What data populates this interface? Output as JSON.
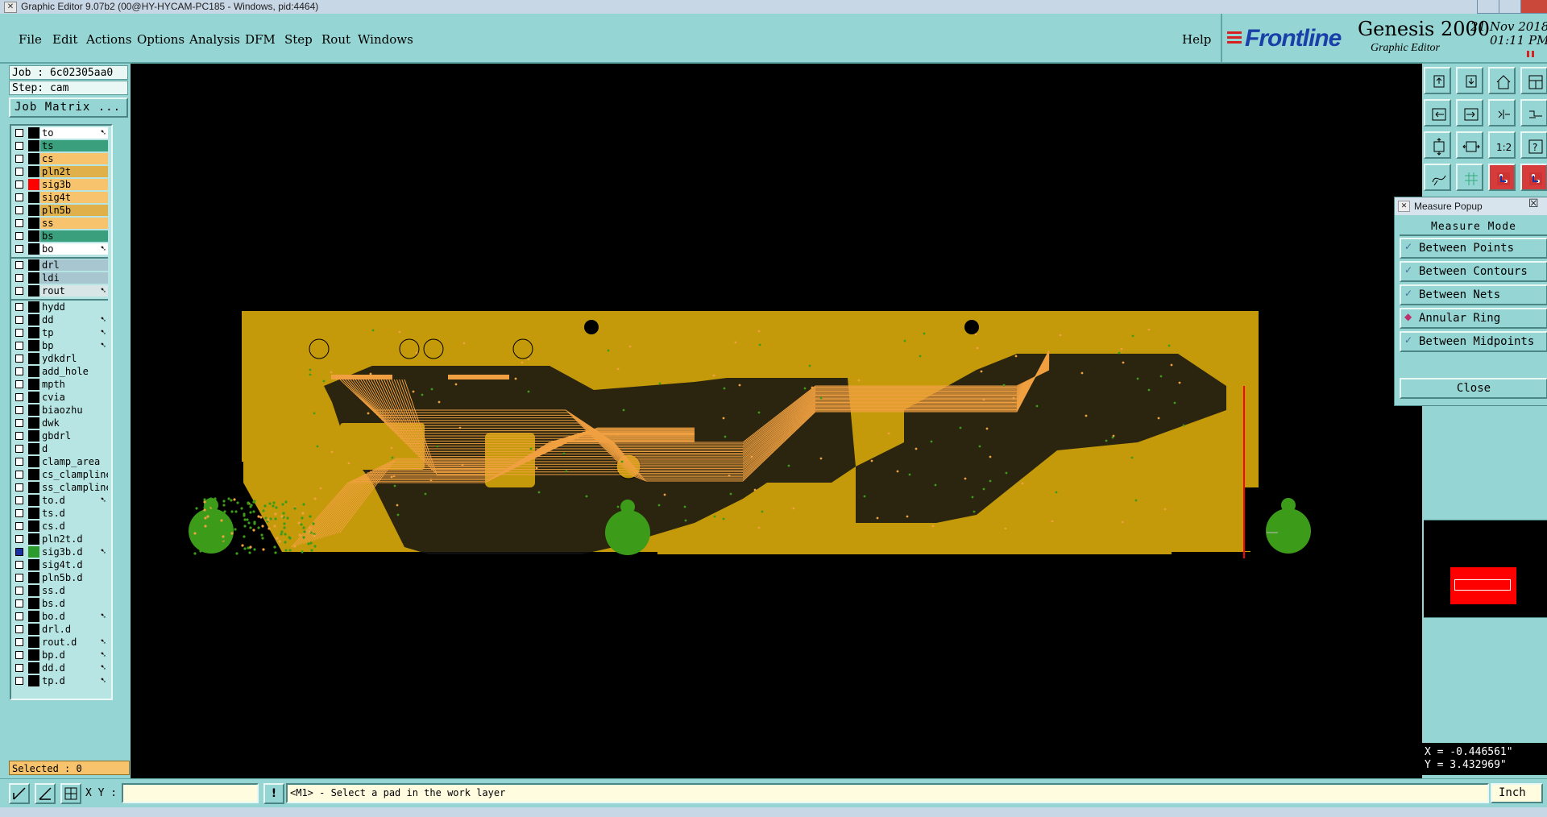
{
  "window": {
    "title": "Graphic Editor 9.07b2 (00@HY-HYCAM-PC185 - Windows, pid:4464)"
  },
  "menu": {
    "items": [
      {
        "label": "File"
      },
      {
        "label": "Edit"
      },
      {
        "label": "Actions"
      },
      {
        "label": "Options"
      },
      {
        "label": "Analysis"
      },
      {
        "label": "DFM"
      },
      {
        "label": "Step"
      },
      {
        "label": "Rout"
      },
      {
        "label": "Windows"
      }
    ],
    "help": "Help"
  },
  "brand": {
    "logo": "Frontline",
    "product": "Genesis 2000",
    "subtitle": "Graphic Editor",
    "date": "21 Nov 2018",
    "time": "01:11 PM"
  },
  "job": {
    "job_label": "Job : 6c02305aa0",
    "step_label": "Step: cam",
    "matrix_button": "Job Matrix ..."
  },
  "layers": [
    {
      "name": "to",
      "color": "#ffffff",
      "arrow": true,
      "marker": ""
    },
    {
      "name": "ts",
      "color": "#3a9f7d",
      "arrow": false,
      "marker": ""
    },
    {
      "name": "cs",
      "color": "#f7c36d",
      "arrow": false,
      "marker": ""
    },
    {
      "name": "pln2t",
      "color": "#e0b04a",
      "arrow": false,
      "marker": ""
    },
    {
      "name": "sig3b",
      "color": "#f7c36d",
      "arrow": false,
      "marker": "#ff0000"
    },
    {
      "name": "sig4t",
      "color": "#f7c36d",
      "arrow": false,
      "marker": ""
    },
    {
      "name": "pln5b",
      "color": "#e0b04a",
      "arrow": false,
      "marker": ""
    },
    {
      "name": "ss",
      "color": "#f7c36d",
      "arrow": false,
      "marker": ""
    },
    {
      "name": "bs",
      "color": "#3a9f7d",
      "arrow": false,
      "marker": ""
    },
    {
      "name": "bo",
      "color": "#ffffff",
      "arrow": true,
      "marker": ""
    },
    {
      "name": "drl",
      "color": "#a8c6cf",
      "arrow": false,
      "marker": ""
    },
    {
      "name": "ldi",
      "color": "#a8c6cf",
      "arrow": false,
      "marker": ""
    },
    {
      "name": "rout",
      "color": "#d9e6e8",
      "arrow": true,
      "marker": ""
    },
    {
      "name": "hydd",
      "color": "#b6e5e3",
      "arrow": false,
      "marker": ""
    },
    {
      "name": "dd",
      "color": "#b6e5e3",
      "arrow": true,
      "marker": ""
    },
    {
      "name": "tp",
      "color": "#b6e5e3",
      "arrow": true,
      "marker": ""
    },
    {
      "name": "bp",
      "color": "#b6e5e3",
      "arrow": true,
      "marker": ""
    },
    {
      "name": "ydkdrl",
      "color": "#b6e5e3",
      "arrow": false,
      "marker": ""
    },
    {
      "name": "add_hole",
      "color": "#b6e5e3",
      "arrow": false,
      "marker": ""
    },
    {
      "name": "mpth",
      "color": "#b6e5e3",
      "arrow": false,
      "marker": ""
    },
    {
      "name": "cvia",
      "color": "#b6e5e3",
      "arrow": false,
      "marker": ""
    },
    {
      "name": "biaozhu",
      "color": "#b6e5e3",
      "arrow": false,
      "marker": ""
    },
    {
      "name": "dwk",
      "color": "#b6e5e3",
      "arrow": false,
      "marker": ""
    },
    {
      "name": "gbdrl",
      "color": "#b6e5e3",
      "arrow": false,
      "marker": ""
    },
    {
      "name": "d",
      "color": "#b6e5e3",
      "arrow": false,
      "marker": ""
    },
    {
      "name": "clamp_area",
      "color": "#b6e5e3",
      "arrow": false,
      "marker": ""
    },
    {
      "name": "cs_clampline",
      "color": "#b6e5e3",
      "arrow": false,
      "marker": ""
    },
    {
      "name": "ss_clampline",
      "color": "#b6e5e3",
      "arrow": false,
      "marker": ""
    },
    {
      "name": "to.d",
      "color": "#b6e5e3",
      "arrow": true,
      "marker": ""
    },
    {
      "name": "ts.d",
      "color": "#b6e5e3",
      "arrow": false,
      "marker": ""
    },
    {
      "name": "cs.d",
      "color": "#b6e5e3",
      "arrow": false,
      "marker": ""
    },
    {
      "name": "pln2t.d",
      "color": "#b6e5e3",
      "arrow": false,
      "marker": ""
    },
    {
      "name": "sig3b.d",
      "color": "#b6e5e3",
      "arrow": true,
      "marker": "#2d9a2d",
      "checked": true
    },
    {
      "name": "sig4t.d",
      "color": "#b6e5e3",
      "arrow": false,
      "marker": ""
    },
    {
      "name": "pln5b.d",
      "color": "#b6e5e3",
      "arrow": false,
      "marker": ""
    },
    {
      "name": "ss.d",
      "color": "#b6e5e3",
      "arrow": false,
      "marker": ""
    },
    {
      "name": "bs.d",
      "color": "#b6e5e3",
      "arrow": false,
      "marker": ""
    },
    {
      "name": "bo.d",
      "color": "#b6e5e3",
      "arrow": true,
      "marker": ""
    },
    {
      "name": "drl.d",
      "color": "#b6e5e3",
      "arrow": false,
      "marker": ""
    },
    {
      "name": "rout.d",
      "color": "#b6e5e3",
      "arrow": true,
      "marker": ""
    },
    {
      "name": "bp.d",
      "color": "#b6e5e3",
      "arrow": true,
      "marker": ""
    },
    {
      "name": "dd.d",
      "color": "#b6e5e3",
      "arrow": true,
      "marker": ""
    },
    {
      "name": "tp.d",
      "color": "#b6e5e3",
      "arrow": true,
      "marker": ""
    }
  ],
  "selected_label": "Selected : 0",
  "toolbar_icons": [
    "layer-up-icon",
    "layer-down-icon",
    "home-icon",
    "window-icon",
    "move-left-icon",
    "move-right-icon",
    "snap-icon",
    "zigzag-icon",
    "fit-vertical-icon",
    "fit-horizontal-icon",
    "scale-1-2-icon",
    "help-icon",
    "draw-icon",
    "grid-icon",
    "net-red-icon",
    "net-red2-icon"
  ],
  "scale_label": "1:2",
  "help_glyph": "?",
  "measure_popup": {
    "title": "Measure Popup",
    "heading": "Measure Mode",
    "options": [
      {
        "label": "Between Points",
        "selected": false
      },
      {
        "label": "Between Contours",
        "selected": false
      },
      {
        "label": "Between Nets",
        "selected": false
      },
      {
        "label": "Annular Ring",
        "selected": true
      },
      {
        "label": "Between Midpoints",
        "selected": false
      }
    ],
    "close": "Close"
  },
  "coordinates": {
    "x": "X = -0.446561\"",
    "y": "Y = 3.432969\""
  },
  "status": {
    "xy_label": "X Y :",
    "xy_value": "",
    "prompt": "<M1> - Select a pad in the work layer",
    "units": "Inch"
  },
  "colors": {
    "panel": "#95d6d4",
    "copper": "#c49a0a",
    "green": "#3c9c1a",
    "trace": "#f0a040",
    "highlight": "#ff0000"
  }
}
